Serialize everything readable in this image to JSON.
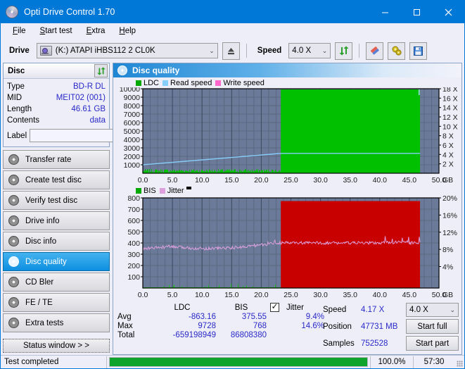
{
  "window": {
    "title": "Opti Drive Control 1.70",
    "icon": "disc-icon",
    "minimize": "–",
    "maximize": "□",
    "close": "✕",
    "accent": "#0078d7"
  },
  "menu": {
    "items": [
      {
        "label": "File",
        "accel": "F"
      },
      {
        "label": "Start test",
        "accel": "S"
      },
      {
        "label": "Extra",
        "accel": "E"
      },
      {
        "label": "Help",
        "accel": "H"
      }
    ]
  },
  "toolbar": {
    "drive_label": "Drive",
    "drive_value": "(K:)  ATAPI iHBS112  2 CL0K",
    "eject_icon": "eject-icon",
    "speed_label": "Speed",
    "speed_value": "4.0 X",
    "refresh_icon": "refresh-icon",
    "erase_icon": "eraser-icon",
    "settings_icon": "gears-icon",
    "save_icon": "floppy-save-icon"
  },
  "disc": {
    "header": "Disc",
    "refresh_icon": "refresh-arrows-icon",
    "rows": [
      {
        "key": "Type",
        "value": "BD-R DL"
      },
      {
        "key": "MID",
        "value": "MEIT02 (001)"
      },
      {
        "key": "Length",
        "value": "46.61 GB"
      },
      {
        "key": "Contents",
        "value": "data"
      }
    ],
    "label_key": "Label",
    "label_value": "",
    "label_placeholder": "",
    "label_button_icon": "cd-icon"
  },
  "nav": {
    "items": [
      {
        "label": "Transfer rate",
        "active": false
      },
      {
        "label": "Create test disc",
        "active": false
      },
      {
        "label": "Verify test disc",
        "active": false
      },
      {
        "label": "Drive info",
        "active": false
      },
      {
        "label": "Disc info",
        "active": false
      },
      {
        "label": "Disc quality",
        "active": true
      },
      {
        "label": "CD Bler",
        "active": false
      },
      {
        "label": "FE / TE",
        "active": false
      },
      {
        "label": "Extra tests",
        "active": false
      }
    ],
    "status_window": "Status window > >"
  },
  "panel": {
    "title": "Disc quality",
    "icon": "disc-quality-icon"
  },
  "chart_data": [
    {
      "type": "area",
      "id": "ldc-chart",
      "title": "",
      "xlabel": "GB",
      "ylabel": "",
      "legend": [
        {
          "label": "LDC",
          "color": "#00a800"
        },
        {
          "label": "Read speed",
          "color": "#87cefa"
        },
        {
          "label": "Write speed",
          "color": "#ff66cc"
        }
      ],
      "legend_position": "top-left",
      "grid": true,
      "plot_bg": "#6b7a99",
      "xlim": [
        0,
        50
      ],
      "xticks": [
        "0.0",
        "5.0",
        "10.0",
        "15.0",
        "20.0",
        "25.0",
        "30.0",
        "35.0",
        "40.0",
        "45.0",
        "50.0"
      ],
      "x_unit": "GB",
      "ylim": [
        0,
        10000
      ],
      "yticks": [
        "10000",
        "9000",
        "8000",
        "7000",
        "6000",
        "5000",
        "4000",
        "3000",
        "2000",
        "1000"
      ],
      "y2lim": [
        0,
        18
      ],
      "y2ticks": [
        "18 X",
        "16 X",
        "14 X",
        "12 X",
        "10 X",
        "8 X",
        "6 X",
        "4 X",
        "2 X"
      ],
      "series": [
        {
          "name": "LDC",
          "color": "#00c000",
          "note": "low noise 0-23.3GB, saturated full-height block 23.3-46.8GB"
        },
        {
          "name": "Read speed",
          "color": "#87cefa",
          "note": "rises from ~1000 at 0GB to ~2350 at 23GB then flat to 46.8GB"
        }
      ],
      "data_end_gb": 46.8,
      "saturation_start_gb": 23.3
    },
    {
      "type": "area",
      "id": "bis-chart",
      "title": "",
      "xlabel": "GB",
      "ylabel": "",
      "legend": [
        {
          "label": "BIS",
          "color": "#00a800"
        },
        {
          "label": "Jitter",
          "color": "#dda0dd"
        }
      ],
      "legend_position": "top-left",
      "grid": true,
      "plot_bg": "#6b7a99",
      "xlim": [
        0,
        50
      ],
      "xticks": [
        "0.0",
        "5.0",
        "10.0",
        "15.0",
        "20.0",
        "25.0",
        "30.0",
        "35.0",
        "40.0",
        "45.0",
        "50.0"
      ],
      "x_unit": "GB",
      "ylim": [
        0,
        800
      ],
      "yticks": [
        "800",
        "700",
        "600",
        "500",
        "400",
        "300",
        "200",
        "100"
      ],
      "y2lim": [
        0,
        20
      ],
      "y2ticks": [
        "20%",
        "16%",
        "12%",
        "8%",
        "4%"
      ],
      "series": [
        {
          "name": "BIS",
          "color": "#c80000",
          "note": "near-zero 0-23.3GB, full red block 23.3-46.8GB"
        },
        {
          "name": "Jitter",
          "color": "#dda0dd",
          "note": "~350 at 0GB drifting to ~400-420 with spikes to ~470 near 45GB"
        }
      ],
      "data_end_gb": 46.8,
      "saturation_start_gb": 23.3
    }
  ],
  "stats": {
    "columns": [
      "LDC",
      "BIS"
    ],
    "jitter_label": "Jitter",
    "jitter_checked": true,
    "rows": [
      {
        "label": "Avg",
        "ldc": "-863.16",
        "bis": "375.55",
        "jitter": "9.4%"
      },
      {
        "label": "Max",
        "ldc": "9728",
        "bis": "768",
        "jitter": "14.6%"
      },
      {
        "label": "Total",
        "ldc": "-659198949",
        "bis": "86808380",
        "jitter": ""
      }
    ]
  },
  "readout": {
    "speed_label": "Speed",
    "speed_value": "4.17 X",
    "position_label": "Position",
    "position_value": "47731 MB",
    "samples_label": "Samples",
    "samples_value": "752528",
    "speed_select": "4.0 X",
    "start_full": "Start full",
    "start_part": "Start part"
  },
  "statusbar": {
    "message": "Test completed",
    "progress_percent": 100.0,
    "progress_text": "100.0%",
    "elapsed": "57:30"
  }
}
